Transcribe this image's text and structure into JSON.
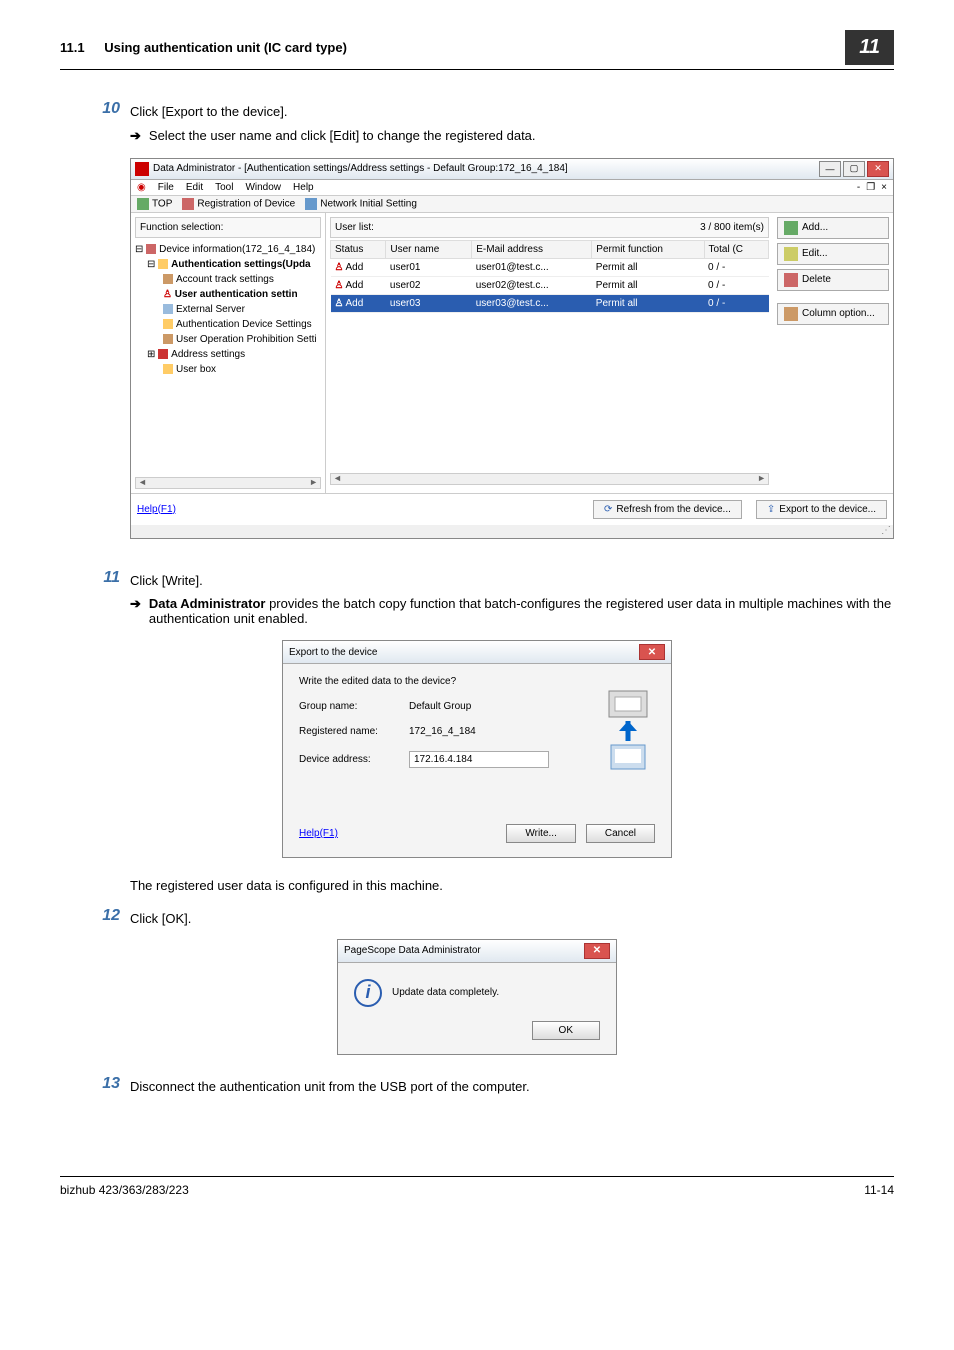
{
  "header": {
    "section_num": "11.1",
    "section_title": "Using authentication unit (IC card type)",
    "badge": "11"
  },
  "steps": {
    "s10": {
      "num": "10",
      "text": "Click [Export to the device].",
      "sub": "Select the user name and click [Edit] to change the registered data."
    },
    "s11": {
      "num": "11",
      "text": "Click [Write].",
      "sub_prefix": "Data Administrator",
      "sub_rest": " provides the batch copy function that batch-configures the registered user data in multiple machines with the authentication unit enabled."
    },
    "s11_post": "The registered user data is configured in this machine.",
    "s12": {
      "num": "12",
      "text": "Click [OK]."
    },
    "s13": {
      "num": "13",
      "text": "Disconnect the authentication unit from the USB port of the computer."
    }
  },
  "window1": {
    "title": "Data Administrator - [Authentication settings/Address settings - Default Group:172_16_4_184]",
    "menus": [
      "File",
      "Edit",
      "Tool",
      "Window",
      "Help"
    ],
    "toolbar": {
      "top": "TOP",
      "reg": "Registration of Device",
      "net": "Network Initial Setting"
    },
    "func_label": "Function selection:",
    "tree": {
      "root": "Device information(172_16_4_184)",
      "auth": "Authentication settings(Upda",
      "acct": "Account track settings",
      "userauth": "User authentication settin",
      "ext": "External Server",
      "ads": "Authentication Device Settings",
      "uop": "User Operation Prohibition Setti",
      "addr": "Address settings",
      "ubox": "User box"
    },
    "userlist_label": "User list:",
    "count": "3 / 800 item(s)",
    "cols": {
      "status": "Status",
      "uname": "User name",
      "email": "E-Mail address",
      "permit": "Permit function",
      "total": "Total (C"
    },
    "rows": [
      {
        "status": "Add",
        "uname": "user01",
        "email": "user01@test.c...",
        "permit": "Permit all",
        "total": "0 / -"
      },
      {
        "status": "Add",
        "uname": "user02",
        "email": "user02@test.c...",
        "permit": "Permit all",
        "total": "0 / -"
      },
      {
        "status": "Add",
        "uname": "user03",
        "email": "user03@test.c...",
        "permit": "Permit all",
        "total": "0 / -"
      }
    ],
    "actions": {
      "add": "Add...",
      "edit": "Edit...",
      "del": "Delete",
      "col": "Column option..."
    },
    "help": "Help(F1)",
    "refresh": "Refresh from the device...",
    "export": "Export to the device..."
  },
  "dialog1": {
    "title": "Export to the device",
    "prompt": "Write the edited data to the device?",
    "group_lbl": "Group name:",
    "group_val": "Default Group",
    "reg_lbl": "Registered name:",
    "reg_val": "172_16_4_184",
    "addr_lbl": "Device address:",
    "addr_val": "172.16.4.184",
    "help": "Help(F1)",
    "write": "Write...",
    "cancel": "Cancel"
  },
  "dialog2": {
    "title": "PageScope Data Administrator",
    "msg": "Update data completely.",
    "ok": "OK"
  },
  "footer": {
    "left": "bizhub 423/363/283/223",
    "right": "11-14"
  }
}
